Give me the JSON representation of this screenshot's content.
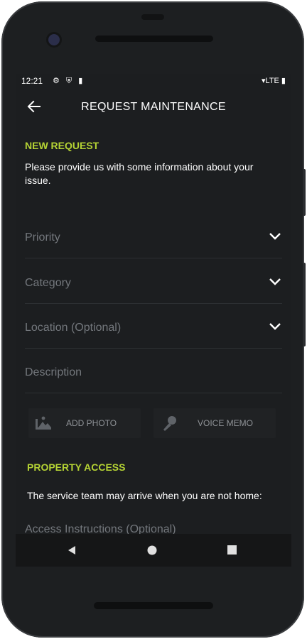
{
  "status_bar": {
    "time": "12:21",
    "left_icons": "⚙ ⛨ ▮",
    "right_icons": "▾LTE ▮"
  },
  "app_bar": {
    "title": "REQUEST MAINTENANCE"
  },
  "new_request": {
    "heading": "NEW REQUEST",
    "intro_line1": "Please provide us with some information about your",
    "intro_line2": "issue."
  },
  "fields": {
    "priority": "Priority",
    "category": "Category",
    "location": "Location (Optional)",
    "description": "Description"
  },
  "actions": {
    "add_photo": "ADD PHOTO",
    "voice_memo": "VOICE MEMO"
  },
  "property_access": {
    "heading": "PROPERTY ACCESS",
    "text": "The service team may arrive when you are not home:",
    "access_instructions": "Access Instructions (Optional)"
  },
  "colors": {
    "accent": "#b5d334",
    "background": "#1c1e20",
    "placeholder": "#73777c"
  }
}
